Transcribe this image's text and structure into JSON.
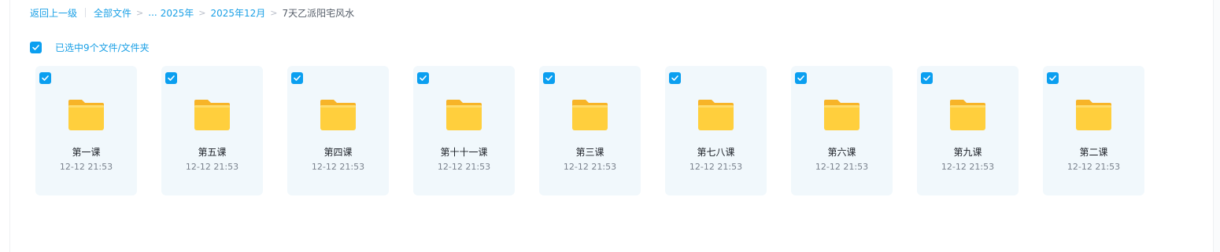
{
  "breadcrumb": {
    "back": "返回上一级",
    "root": "全部文件",
    "ellipsis": "...",
    "level1": "2025年",
    "level2": "2025年12月",
    "current": "7天乙派阳宅风水",
    "separator": ">"
  },
  "selection": {
    "label": "已选中9个文件/文件夹",
    "checked": true
  },
  "folders": [
    {
      "name": "第一课",
      "time": "12-12 21:53"
    },
    {
      "name": "第五课",
      "time": "12-12 21:53"
    },
    {
      "name": "第四课",
      "time": "12-12 21:53"
    },
    {
      "name": "第十十一课",
      "time": "12-12 21:53"
    },
    {
      "name": "第三课",
      "time": "12-12 21:53"
    },
    {
      "name": "第七八课",
      "time": "12-12 21:53"
    },
    {
      "name": "第六课",
      "time": "12-12 21:53"
    },
    {
      "name": "第九课",
      "time": "12-12 21:53"
    },
    {
      "name": "第二课",
      "time": "12-12 21:53"
    }
  ],
  "colors": {
    "accent": "#0b9ff0",
    "link": "#1aa0e6",
    "card_bg": "#f1f8fc",
    "folder_body": "#ffcf3d",
    "folder_tab": "#f7b428"
  },
  "icons": {
    "checkbox": "check-icon",
    "folder": "folder-icon"
  }
}
